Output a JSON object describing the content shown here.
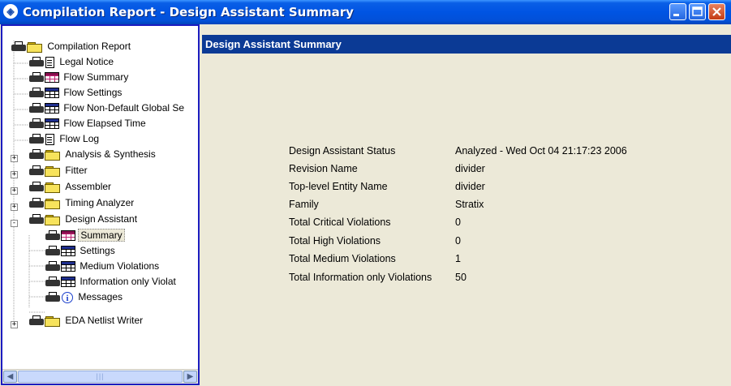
{
  "window": {
    "title": "Compilation Report - Design Assistant Summary"
  },
  "tree": {
    "items": [
      {
        "label": "Compilation Report",
        "icon": "folder-open-icon"
      },
      {
        "label": "Legal Notice",
        "icon": "document-icon"
      },
      {
        "label": "Flow Summary",
        "icon": "table-pink-icon"
      },
      {
        "label": "Flow Settings",
        "icon": "table-icon"
      },
      {
        "label": "Flow Non-Default Global Se",
        "icon": "table-icon"
      },
      {
        "label": "Flow Elapsed Time",
        "icon": "table-icon"
      },
      {
        "label": "Flow Log",
        "icon": "document-icon"
      },
      {
        "label": "Analysis & Synthesis",
        "icon": "folder-icon",
        "expander": "+"
      },
      {
        "label": "Fitter",
        "icon": "folder-icon",
        "expander": "+"
      },
      {
        "label": "Assembler",
        "icon": "folder-icon",
        "expander": "+"
      },
      {
        "label": "Timing Analyzer",
        "icon": "folder-icon",
        "expander": "+"
      },
      {
        "label": "Design Assistant",
        "icon": "folder-open-icon",
        "expander": "-"
      },
      {
        "label": "Summary",
        "icon": "table-pink-icon",
        "selected": true
      },
      {
        "label": "Settings",
        "icon": "table-icon"
      },
      {
        "label": "Medium Violations",
        "icon": "table-icon"
      },
      {
        "label": "Information only Violat",
        "icon": "table-icon"
      },
      {
        "label": "Messages",
        "icon": "info-icon"
      },
      {
        "label": "EDA Netlist Writer",
        "icon": "folder-icon",
        "expander": "+"
      }
    ]
  },
  "panel": {
    "title": "Design Assistant Summary",
    "rows": [
      {
        "key": "Design Assistant Status",
        "value": "Analyzed - Wed Oct 04 21:17:23 2006"
      },
      {
        "key": "Revision Name",
        "value": "divider"
      },
      {
        "key": "Top-level Entity Name",
        "value": "divider"
      },
      {
        "key": "Family",
        "value": "Stratix"
      },
      {
        "key": "Total Critical Violations",
        "value": "0"
      },
      {
        "key": "Total High Violations",
        "value": "0"
      },
      {
        "key": "Total Medium Violations",
        "value": "1"
      },
      {
        "key": "Total Information only Violations",
        "value": "50"
      }
    ]
  }
}
